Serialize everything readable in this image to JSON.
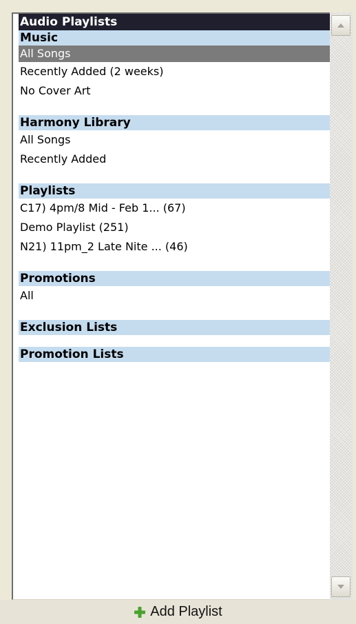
{
  "panel": {
    "title": "Audio Playlists"
  },
  "sections": {
    "music": {
      "header": "Music",
      "items": [
        "All Songs",
        "Recently Added (2 weeks)",
        "No Cover Art"
      ]
    },
    "harmony_library": {
      "header": "Harmony Library",
      "items": [
        "All Songs",
        "Recently Added"
      ]
    },
    "playlists": {
      "header": "Playlists",
      "items": [
        "C17) 4pm/8 Mid - Feb 1... (67)",
        "Demo Playlist (251)",
        "N21) 11pm_2 Late Nite ... (46)"
      ]
    },
    "promotions": {
      "header": "Promotions",
      "items": [
        "All"
      ]
    },
    "exclusion_lists": {
      "header": "Exclusion Lists"
    },
    "promotion_lists": {
      "header": "Promotion Lists"
    }
  },
  "selected_item": "All Songs",
  "footer": {
    "add_playlist_label": "Add Playlist",
    "add_icon": "plus-icon"
  },
  "colors": {
    "title_bg": "#1f1f2e",
    "section_header_bg": "#c5dcef",
    "selected_bg": "#7b7b7b",
    "plus_icon": "#4aa12e"
  }
}
